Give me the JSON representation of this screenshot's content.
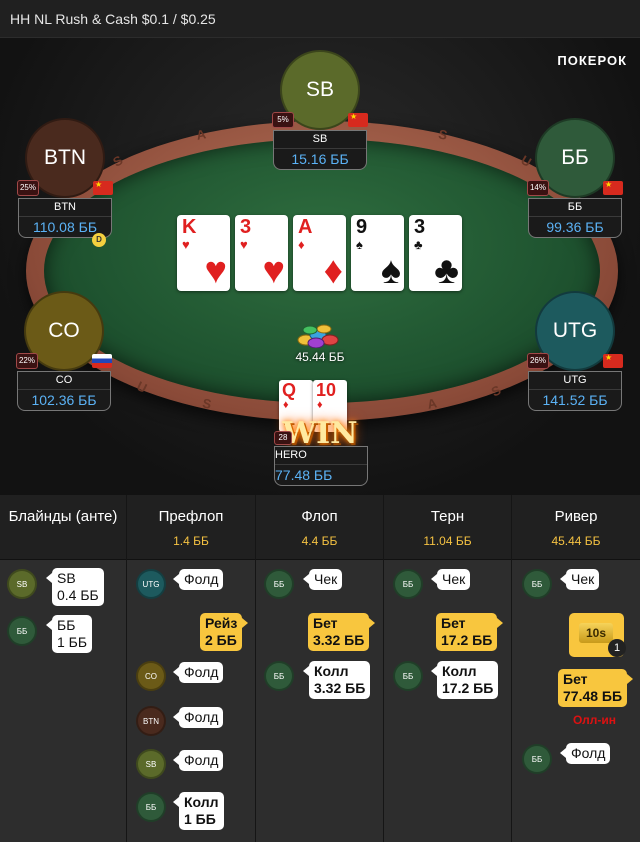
{
  "header": {
    "title": "HH NL Rush & Cash $0.1 / $0.25",
    "logo": "ПОКЕРОК"
  },
  "table": {
    "rail_letters": [
      "S",
      "A",
      "S",
      "U",
      "S",
      "A",
      "S",
      "U"
    ],
    "seats": [
      {
        "id": "sb",
        "avatar": "SB",
        "name": "SB",
        "stack": "15.16 ББ",
        "pct": "5%",
        "flag": "cn",
        "color": "#5b6a2a"
      },
      {
        "id": "btn",
        "avatar": "BTN",
        "name": "BTN",
        "stack": "110.08 ББ",
        "pct": "25%",
        "flag": "cn",
        "color": "#4a2a1e"
      },
      {
        "id": "bb",
        "avatar": "ББ",
        "name": "ББ",
        "stack": "99.36 ББ",
        "pct": "14%",
        "flag": "cn",
        "color": "#2f5a3a"
      },
      {
        "id": "co",
        "avatar": "CO",
        "name": "CO",
        "stack": "102.36 ББ",
        "pct": "22%",
        "flag": "ru",
        "color": "#6b5a17"
      },
      {
        "id": "utg",
        "avatar": "UTG",
        "name": "UTG",
        "stack": "141.52 ББ",
        "pct": "26%",
        "flag": "cn",
        "color": "#1d5a5e"
      }
    ],
    "dealer_button": "D",
    "board": [
      {
        "rank": "K",
        "suit": "♥",
        "color": "red"
      },
      {
        "rank": "3",
        "suit": "♥",
        "color": "red"
      },
      {
        "rank": "A",
        "suit": "♦",
        "color": "red"
      },
      {
        "rank": "9",
        "suit": "♠",
        "color": "black"
      },
      {
        "rank": "3",
        "suit": "♣",
        "color": "black"
      }
    ],
    "pot": "45.44 ББ",
    "hero": {
      "name": "HERO",
      "stack": "77.48 ББ",
      "pct": "28",
      "win_label": "WIN",
      "cards": [
        {
          "rank": "Q",
          "suit": "♦",
          "color": "red"
        },
        {
          "rank": "10",
          "suit": "♦",
          "color": "red"
        }
      ]
    }
  },
  "history": {
    "streets": [
      {
        "title": "Блайнды (анте)",
        "pot": ""
      },
      {
        "title": "Префлоп",
        "pot": "1.4 ББ"
      },
      {
        "title": "Флоп",
        "pot": "4.4 ББ"
      },
      {
        "title": "Терн",
        "pot": "11.04 ББ"
      },
      {
        "title": "Ривер",
        "pot": "45.44 ББ"
      }
    ],
    "blinds": [
      {
        "pos": "SB",
        "text": "SB\n0.4 ББ"
      },
      {
        "pos": "ББ",
        "text": "ББ\n1 ББ"
      }
    ],
    "preflop": [
      {
        "pos": "UTG",
        "text": "Фолд"
      },
      {
        "pos": "",
        "text": "Рейз\n2 ББ"
      },
      {
        "pos": "CO",
        "text": "Фолд"
      },
      {
        "pos": "BTN",
        "text": "Фолд"
      },
      {
        "pos": "SB",
        "text": "Фолд"
      },
      {
        "pos": "ББ",
        "text": "Колл\n1 ББ"
      }
    ],
    "flop": [
      {
        "pos": "ББ",
        "text": "Чек"
      },
      {
        "pos": "",
        "text": "Бет\n3.32 ББ"
      },
      {
        "pos": "ББ",
        "text": "Колл\n3.32 ББ"
      }
    ],
    "turn": [
      {
        "pos": "ББ",
        "text": "Чек"
      },
      {
        "pos": "",
        "text": "Бет\n17.2 ББ"
      },
      {
        "pos": "ББ",
        "text": "Колл\n17.2 ББ"
      }
    ],
    "river": [
      {
        "pos": "ББ",
        "text": "Чек"
      },
      {
        "pos": "",
        "text": "Бет\n77.48 ББ"
      },
      {
        "pos": "ББ",
        "text": "Фолд"
      }
    ],
    "timebank": {
      "label": "10s",
      "count": "1"
    },
    "allin_label": "Олл-ин"
  }
}
